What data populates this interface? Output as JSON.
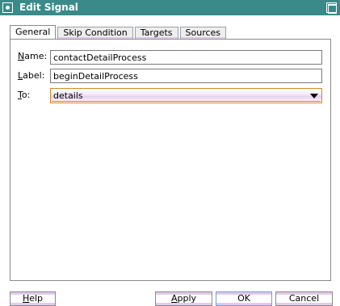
{
  "window": {
    "title": "Edit Signal"
  },
  "tabs": [
    {
      "label": "General",
      "active": true
    },
    {
      "label": "Skip Condition",
      "active": false
    },
    {
      "label": "Targets",
      "active": false
    },
    {
      "label": "Sources",
      "active": false
    }
  ],
  "form": {
    "name": {
      "label_mnemonic": "N",
      "label_rest": "ame:",
      "value": "contactDetailProcess"
    },
    "label": {
      "label_mnemonic": "L",
      "label_rest": "abel:",
      "value": "beginDetailProcess"
    },
    "to": {
      "label_mnemonic": "T",
      "label_rest": "o:",
      "selected": "details"
    }
  },
  "buttons": {
    "help": {
      "mnemonic": "H",
      "rest": "elp"
    },
    "apply": {
      "mnemonic": "A",
      "rest": "pply"
    },
    "ok": {
      "label": "OK"
    },
    "cancel": {
      "label": "Cancel"
    }
  },
  "colors": {
    "titlebar": "#3a8a8a",
    "accent": "#d08a2a",
    "button_stripe": "#e3cbe9"
  }
}
